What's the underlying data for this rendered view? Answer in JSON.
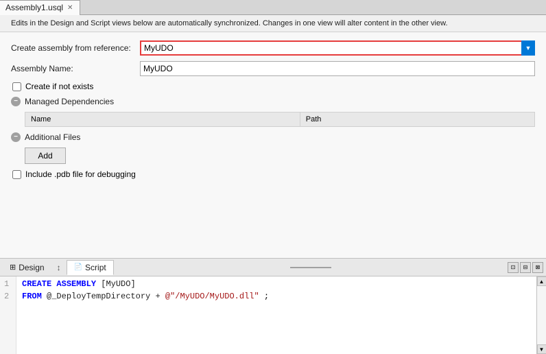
{
  "tab": {
    "label": "Assembly1.usql",
    "close_icon": "✕"
  },
  "info_bar": {
    "text": "Edits in the Design and Script views below are automatically synchronized. Changes in one view will alter content in the other view."
  },
  "form": {
    "create_assembly_label": "Create assembly from reference:",
    "create_assembly_value": "MyUDO",
    "assembly_name_label": "Assembly Name:",
    "assembly_name_value": "MyUDO",
    "create_if_not_exists_label": "Create if not exists",
    "managed_deps_label": "Managed Dependencies",
    "additional_files_label": "Additional Files",
    "include_pdb_label": "Include .pdb file for debugging",
    "table_col_name": "Name",
    "table_col_path": "Path",
    "add_btn_label": "Add"
  },
  "bottom": {
    "design_tab_label": "Design",
    "arrows_icon": "↕",
    "script_tab_label": "Script",
    "code_lines": [
      {
        "num": "1",
        "content": "CREATE ASSEMBLY [MyUDO]"
      },
      {
        "num": "2",
        "content": "FROM @_DeployTempDirectory + @\"/MyUDO/MyUDO.dll\";"
      }
    ]
  },
  "icons": {
    "design_icon": "⊞",
    "script_icon": "📄",
    "panel_icon1": "⊡",
    "panel_icon2": "⊟",
    "panel_icon3": "⊠"
  }
}
